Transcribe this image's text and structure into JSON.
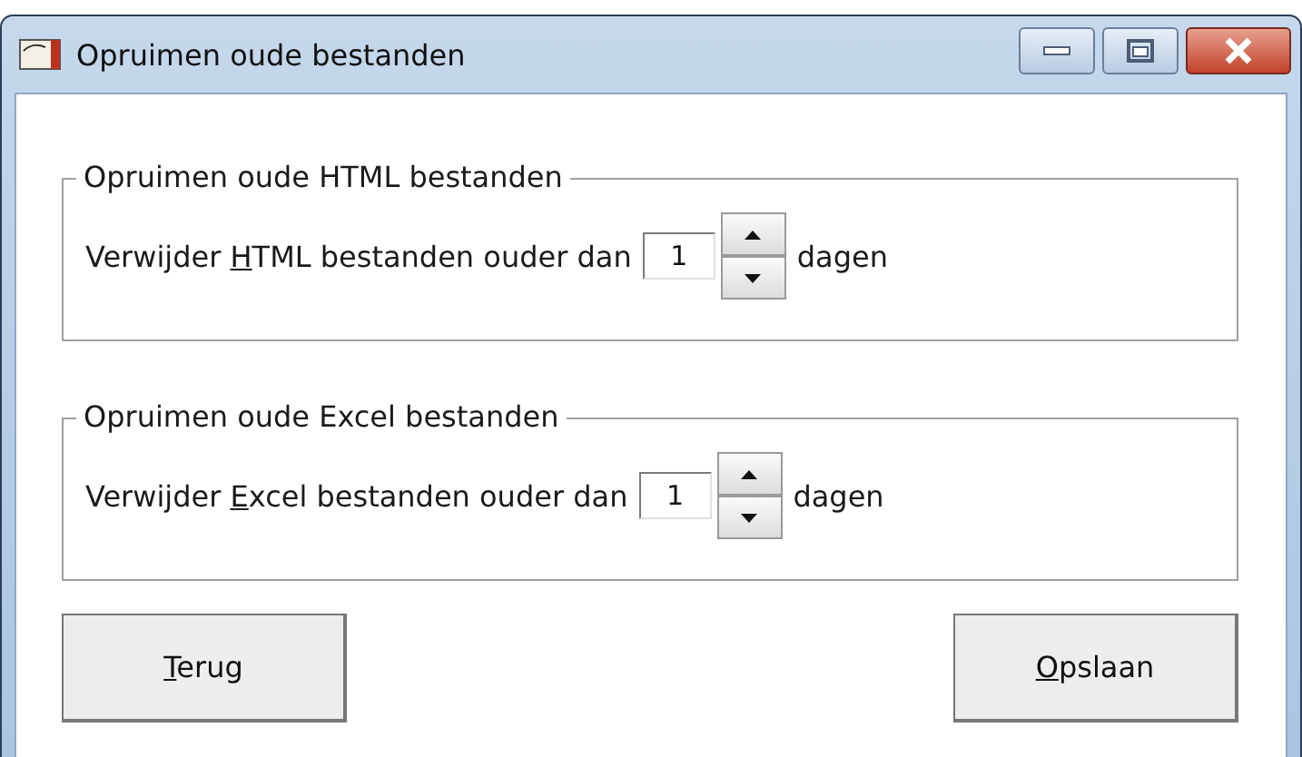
{
  "window": {
    "title": "Opruimen oude bestanden"
  },
  "groups": [
    {
      "title": "Opruimen oude HTML bestanden",
      "label_before": "Verwijder ",
      "mnemonic": "H",
      "label_after": "TML bestanden ouder dan",
      "value": "1",
      "unit": "dagen"
    },
    {
      "title": "Opruimen oude Excel bestanden",
      "label_before": "Verwijder ",
      "mnemonic": "E",
      "label_after": "xcel bestanden ouder dan",
      "value": "1",
      "unit": "dagen"
    }
  ],
  "buttons": [
    {
      "mnemonic": "T",
      "rest": "erug"
    },
    {
      "mnemonic": "O",
      "rest": "pslaan"
    }
  ]
}
